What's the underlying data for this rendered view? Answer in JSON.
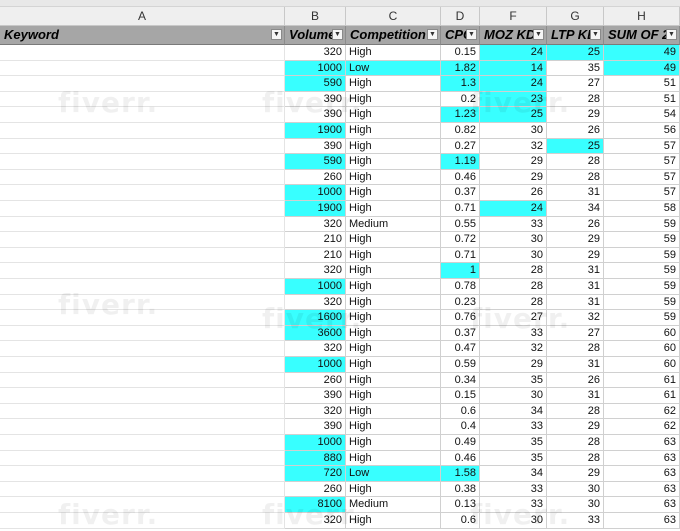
{
  "column_letters": [
    "A",
    "B",
    "C",
    "D",
    "F",
    "G",
    "H"
  ],
  "headers": [
    {
      "key": "keyword",
      "label": "Keyword",
      "filter": true
    },
    {
      "key": "volume",
      "label": "Volume",
      "filter": true
    },
    {
      "key": "competition",
      "label": "Competition",
      "filter": true
    },
    {
      "key": "cpc",
      "label": "CPC",
      "filter": true
    },
    {
      "key": "moz",
      "label": "MOZ KD",
      "filter": true
    },
    {
      "key": "ltp",
      "label": "LTP KD",
      "filter": true
    },
    {
      "key": "sum",
      "label": "SUM OF 2",
      "filter": true
    }
  ],
  "filter_icon": "dropdown-arrow-icon",
  "highlight_color": "#38ffff",
  "watermark": "fiverr.",
  "rows": [
    {
      "volume": "320",
      "competition": "High",
      "cpc": "0.15",
      "moz": "24",
      "ltp": "25",
      "sum": "49",
      "hl": [
        "moz",
        "ltp",
        "sum"
      ]
    },
    {
      "volume": "1000",
      "competition": "Low",
      "cpc": "1.82",
      "moz": "14",
      "ltp": "35",
      "sum": "49",
      "hl": [
        "volume",
        "competition",
        "cpc",
        "moz",
        "sum"
      ]
    },
    {
      "volume": "590",
      "competition": "High",
      "cpc": "1.3",
      "moz": "24",
      "ltp": "27",
      "sum": "51",
      "hl": [
        "volume",
        "cpc",
        "moz"
      ]
    },
    {
      "volume": "390",
      "competition": "High",
      "cpc": "0.2",
      "moz": "23",
      "ltp": "28",
      "sum": "51",
      "hl": [
        "moz"
      ]
    },
    {
      "volume": "390",
      "competition": "High",
      "cpc": "1.23",
      "moz": "25",
      "ltp": "29",
      "sum": "54",
      "hl": [
        "cpc",
        "moz"
      ]
    },
    {
      "volume": "1900",
      "competition": "High",
      "cpc": "0.82",
      "moz": "30",
      "ltp": "26",
      "sum": "56",
      "hl": [
        "volume"
      ]
    },
    {
      "volume": "390",
      "competition": "High",
      "cpc": "0.27",
      "moz": "32",
      "ltp": "25",
      "sum": "57",
      "hl": [
        "ltp"
      ]
    },
    {
      "volume": "590",
      "competition": "High",
      "cpc": "1.19",
      "moz": "29",
      "ltp": "28",
      "sum": "57",
      "hl": [
        "volume",
        "cpc"
      ]
    },
    {
      "volume": "260",
      "competition": "High",
      "cpc": "0.46",
      "moz": "29",
      "ltp": "28",
      "sum": "57",
      "hl": []
    },
    {
      "volume": "1000",
      "competition": "High",
      "cpc": "0.37",
      "moz": "26",
      "ltp": "31",
      "sum": "57",
      "hl": [
        "volume"
      ]
    },
    {
      "volume": "1900",
      "competition": "High",
      "cpc": "0.71",
      "moz": "24",
      "ltp": "34",
      "sum": "58",
      "hl": [
        "volume",
        "moz"
      ]
    },
    {
      "volume": "320",
      "competition": "Medium",
      "cpc": "0.55",
      "moz": "33",
      "ltp": "26",
      "sum": "59",
      "hl": []
    },
    {
      "volume": "210",
      "competition": "High",
      "cpc": "0.72",
      "moz": "30",
      "ltp": "29",
      "sum": "59",
      "hl": []
    },
    {
      "volume": "210",
      "competition": "High",
      "cpc": "0.71",
      "moz": "30",
      "ltp": "29",
      "sum": "59",
      "hl": []
    },
    {
      "volume": "320",
      "competition": "High",
      "cpc": "1",
      "moz": "28",
      "ltp": "31",
      "sum": "59",
      "hl": [
        "cpc"
      ]
    },
    {
      "volume": "1000",
      "competition": "High",
      "cpc": "0.78",
      "moz": "28",
      "ltp": "31",
      "sum": "59",
      "hl": [
        "volume"
      ]
    },
    {
      "volume": "320",
      "competition": "High",
      "cpc": "0.23",
      "moz": "28",
      "ltp": "31",
      "sum": "59",
      "hl": []
    },
    {
      "volume": "1600",
      "competition": "High",
      "cpc": "0.76",
      "moz": "27",
      "ltp": "32",
      "sum": "59",
      "hl": [
        "volume"
      ]
    },
    {
      "volume": "3600",
      "competition": "High",
      "cpc": "0.37",
      "moz": "33",
      "ltp": "27",
      "sum": "60",
      "hl": [
        "volume"
      ]
    },
    {
      "volume": "320",
      "competition": "High",
      "cpc": "0.47",
      "moz": "32",
      "ltp": "28",
      "sum": "60",
      "hl": []
    },
    {
      "volume": "1000",
      "competition": "High",
      "cpc": "0.59",
      "moz": "29",
      "ltp": "31",
      "sum": "60",
      "hl": [
        "volume"
      ]
    },
    {
      "volume": "260",
      "competition": "High",
      "cpc": "0.34",
      "moz": "35",
      "ltp": "26",
      "sum": "61",
      "hl": []
    },
    {
      "volume": "390",
      "competition": "High",
      "cpc": "0.15",
      "moz": "30",
      "ltp": "31",
      "sum": "61",
      "hl": []
    },
    {
      "volume": "320",
      "competition": "High",
      "cpc": "0.6",
      "moz": "34",
      "ltp": "28",
      "sum": "62",
      "hl": []
    },
    {
      "volume": "390",
      "competition": "High",
      "cpc": "0.4",
      "moz": "33",
      "ltp": "29",
      "sum": "62",
      "hl": []
    },
    {
      "volume": "1000",
      "competition": "High",
      "cpc": "0.49",
      "moz": "35",
      "ltp": "28",
      "sum": "63",
      "hl": [
        "volume"
      ]
    },
    {
      "volume": "880",
      "competition": "High",
      "cpc": "0.46",
      "moz": "35",
      "ltp": "28",
      "sum": "63",
      "hl": [
        "volume"
      ]
    },
    {
      "volume": "720",
      "competition": "Low",
      "cpc": "1.58",
      "moz": "34",
      "ltp": "29",
      "sum": "63",
      "hl": [
        "volume",
        "competition",
        "cpc"
      ]
    },
    {
      "volume": "260",
      "competition": "High",
      "cpc": "0.38",
      "moz": "33",
      "ltp": "30",
      "sum": "63",
      "hl": []
    },
    {
      "volume": "8100",
      "competition": "Medium",
      "cpc": "0.13",
      "moz": "33",
      "ltp": "30",
      "sum": "63",
      "hl": [
        "volume"
      ]
    },
    {
      "volume": "320",
      "competition": "High",
      "cpc": "0.6",
      "moz": "30",
      "ltp": "33",
      "sum": "63",
      "hl": []
    }
  ]
}
